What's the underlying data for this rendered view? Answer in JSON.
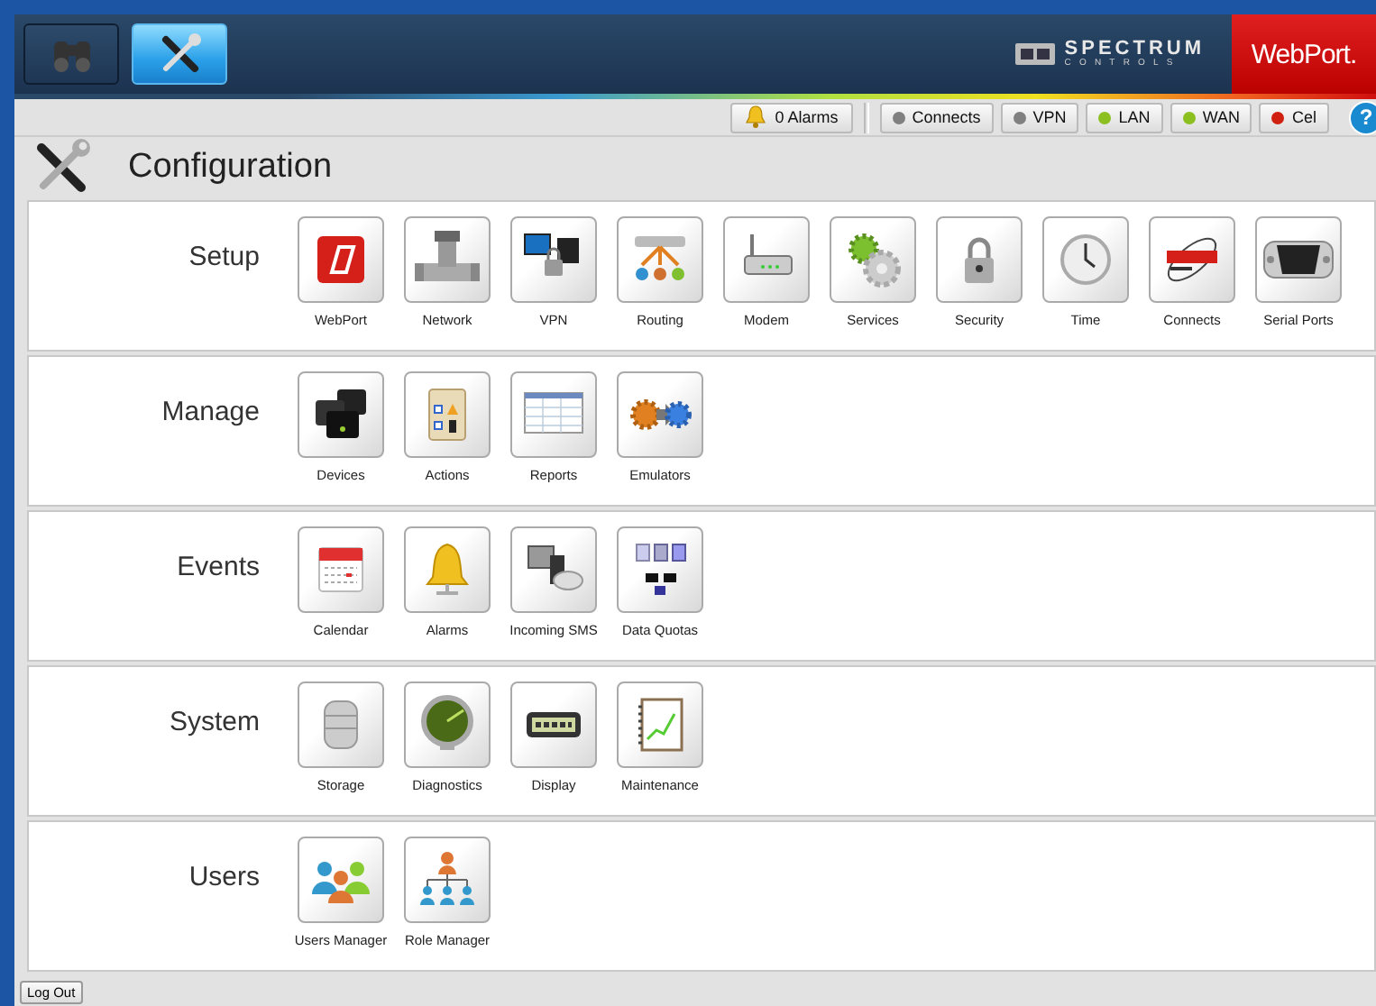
{
  "header": {
    "tabs": [
      {
        "kind": "monitor",
        "selected": false
      },
      {
        "kind": "configure",
        "selected": true
      }
    ],
    "brand": {
      "company": "SPECTRUM",
      "company_sub": "CONTROLS",
      "product": "WebPort."
    }
  },
  "status_bar": {
    "alarms": "0 Alarms",
    "indicators": [
      {
        "label": "Connects",
        "color": "#808080"
      },
      {
        "label": "VPN",
        "color": "#808080"
      },
      {
        "label": "LAN",
        "color": "#8cc020"
      },
      {
        "label": "WAN",
        "color": "#8cc020"
      },
      {
        "label": "Cel",
        "color": "#d02010"
      }
    ],
    "help": "?"
  },
  "page_title": "Configuration",
  "sections": [
    {
      "title": "Setup",
      "items": [
        "WebPort",
        "Network",
        "VPN",
        "Routing",
        "Modem",
        "Services",
        "Security",
        "Time",
        "Connects",
        "Serial Ports"
      ]
    },
    {
      "title": "Manage",
      "items": [
        "Devices",
        "Actions",
        "Reports",
        "Emulators"
      ]
    },
    {
      "title": "Events",
      "items": [
        "Calendar",
        "Alarms",
        "Incoming SMS",
        "Data Quotas"
      ]
    },
    {
      "title": "System",
      "items": [
        "Storage",
        "Diagnostics",
        "Display",
        "Maintenance"
      ]
    },
    {
      "title": "Users",
      "items": [
        "Users Manager",
        "Role Manager"
      ]
    }
  ],
  "logout": "Log Out"
}
